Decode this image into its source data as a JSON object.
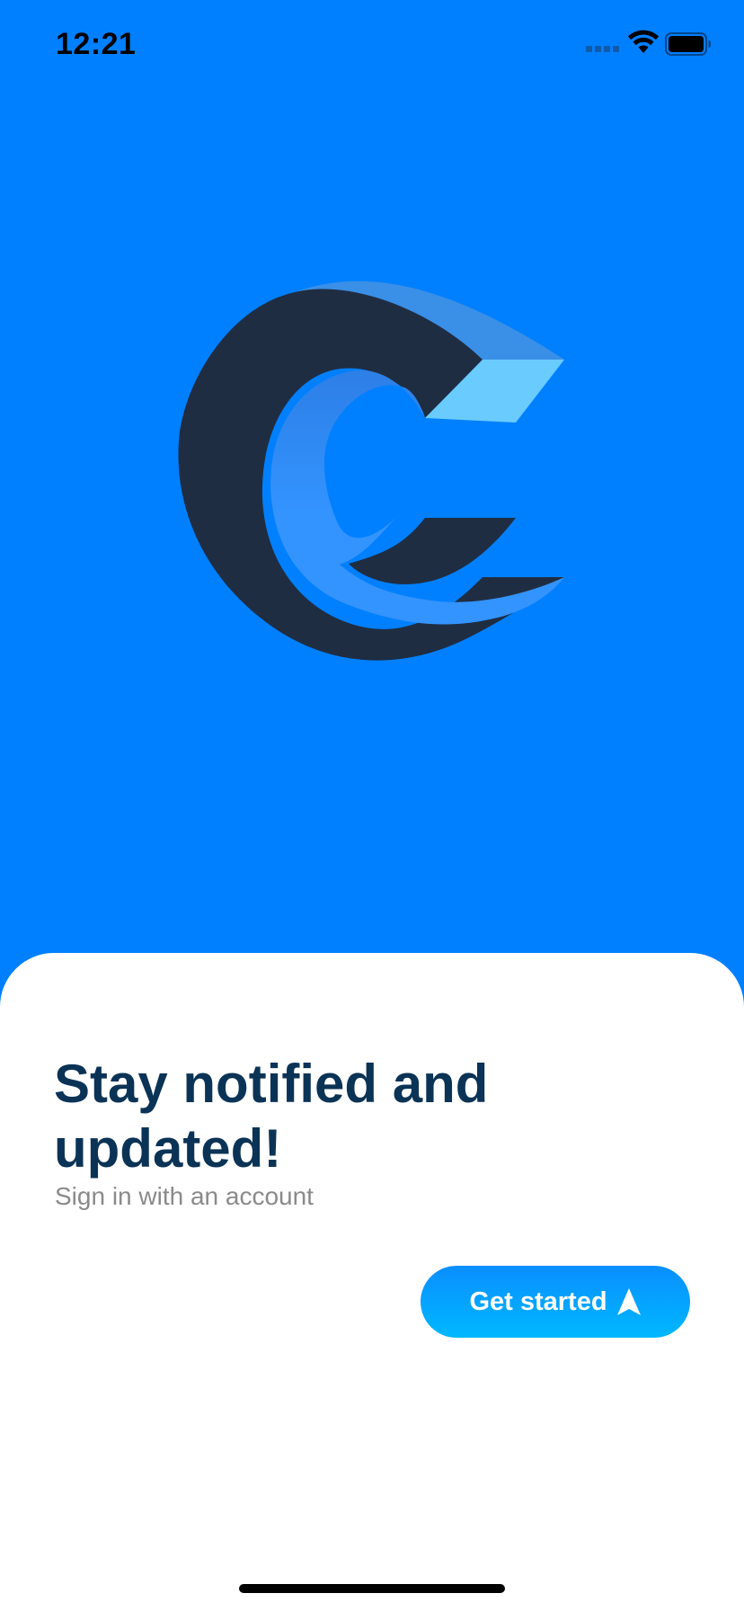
{
  "status_bar": {
    "time": "12:21",
    "icons": [
      "cellular-signal-icon",
      "wifi-icon",
      "battery-icon"
    ]
  },
  "logo": {
    "icon": "c-logo-icon",
    "colors": {
      "dark": "#1F2D42",
      "light_face": "#3A95F0",
      "bright_face": "#6ACBFF",
      "inner": "#2F82E8"
    }
  },
  "card": {
    "headline": "Stay notified and updated!",
    "subtitle": "Sign in with an account",
    "cta_label": "Get started",
    "cta_icon": "navigation-arrow-icon"
  },
  "colors": {
    "background": "#0080FF",
    "headline": "#0B3356",
    "subtitle": "#8A8A8A",
    "button_gradient_top": "#0A8EFF",
    "button_gradient_bottom": "#00B8FF"
  }
}
